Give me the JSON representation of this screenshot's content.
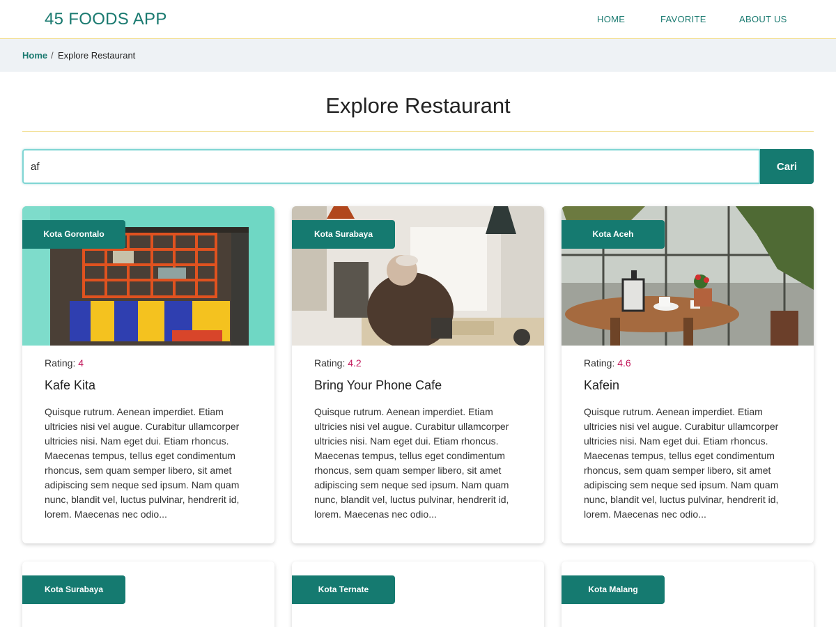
{
  "header": {
    "brand": "45 FOODS APP",
    "nav": [
      {
        "label": "HOME"
      },
      {
        "label": "FAVORITE"
      },
      {
        "label": "ABOUT US"
      }
    ]
  },
  "breadcrumb": {
    "home": "Home",
    "separator": "/",
    "current": "Explore Restaurant"
  },
  "page": {
    "title": "Explore Restaurant"
  },
  "search": {
    "value": "af",
    "button_label": "Cari"
  },
  "rating_label": "Rating:",
  "restaurants": [
    {
      "city": "Kota Gorontalo",
      "rating": "4",
      "name": "Kafe Kita",
      "description": "Quisque rutrum. Aenean imperdiet. Etiam ultricies nisi vel augue. Curabitur ullamcorper ultricies nisi. Nam eget dui. Etiam rhoncus. Maecenas tempus, tellus eget condimentum rhoncus, sem quam semper libero, sit amet adipiscing sem neque sed ipsum. Nam quam nunc, blandit vel, luctus pulvinar, hendrerit id, lorem. Maecenas nec odio..."
    },
    {
      "city": "Kota Surabaya",
      "rating": "4.2",
      "name": "Bring Your Phone Cafe",
      "description": "Quisque rutrum. Aenean imperdiet. Etiam ultricies nisi vel augue. Curabitur ullamcorper ultricies nisi. Nam eget dui. Etiam rhoncus. Maecenas tempus, tellus eget condimentum rhoncus, sem quam semper libero, sit amet adipiscing sem neque sed ipsum. Nam quam nunc, blandit vel, luctus pulvinar, hendrerit id, lorem. Maecenas nec odio..."
    },
    {
      "city": "Kota Aceh",
      "rating": "4.6",
      "name": "Kafein",
      "description": "Quisque rutrum. Aenean imperdiet. Etiam ultricies nisi vel augue. Curabitur ullamcorper ultricies nisi. Nam eget dui. Etiam rhoncus. Maecenas tempus, tellus eget condimentum rhoncus, sem quam semper libero, sit amet adipiscing sem neque sed ipsum. Nam quam nunc, blandit vel, luctus pulvinar, hendrerit id, lorem. Maecenas nec odio..."
    },
    {
      "city": "Kota Surabaya"
    },
    {
      "city": "Kota Ternate"
    },
    {
      "city": "Kota Malang"
    }
  ],
  "colors": {
    "brand": "#1a7a70",
    "button": "#157a70",
    "rating_value": "#c2185b",
    "breadcrumb_bg": "#eef2f5",
    "divider": "#f1dc8a"
  }
}
